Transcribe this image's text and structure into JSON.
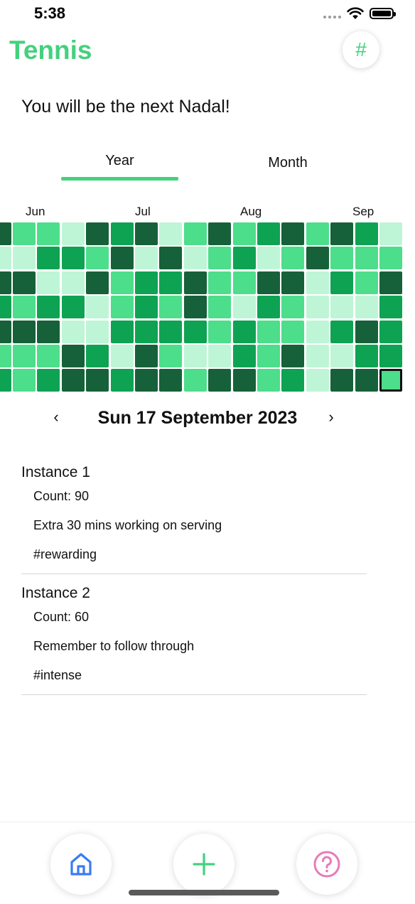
{
  "status_bar": {
    "time": "5:38"
  },
  "header": {
    "title": "Tennis",
    "hash_label": "#"
  },
  "motto": "You will be the next Nadal!",
  "tabs": {
    "year": "Year",
    "month": "Month"
  },
  "heatmap": {
    "months": [
      "Jun",
      "Jul",
      "Aug",
      "Sep"
    ],
    "palette": [
      "#bef5d6",
      "#4cde8a",
      "#0ea352",
      "#166139"
    ],
    "columns": [
      [
        1,
        0,
        3,
        1,
        3,
        1,
        1
      ],
      [
        1,
        2,
        0,
        2,
        3,
        1,
        2
      ],
      [
        0,
        2,
        0,
        2,
        0,
        3,
        3
      ],
      [
        3,
        1,
        3,
        0,
        0,
        2,
        3
      ],
      [
        2,
        3,
        1,
        1,
        2,
        0,
        2
      ],
      [
        3,
        0,
        2,
        2,
        2,
        3,
        3
      ],
      [
        0,
        3,
        2,
        1,
        2,
        1,
        3
      ],
      [
        1,
        0,
        3,
        3,
        2,
        0,
        1
      ],
      [
        3,
        1,
        1,
        1,
        1,
        0,
        3
      ],
      [
        1,
        2,
        1,
        0,
        2,
        2,
        3
      ],
      [
        2,
        0,
        3,
        2,
        1,
        1,
        1
      ],
      [
        3,
        1,
        3,
        1,
        1,
        3,
        2
      ],
      [
        1,
        3,
        0,
        0,
        0,
        0,
        0
      ],
      [
        3,
        1,
        2,
        0,
        2,
        0,
        3
      ],
      [
        2,
        1,
        1,
        0,
        3,
        2,
        3
      ],
      [
        0,
        1,
        3,
        2,
        2,
        2,
        1
      ]
    ],
    "selected": "Sun 17 September 2023"
  },
  "date_nav": {
    "prev": "‹",
    "next": "›",
    "date": "Sun 17 September 2023"
  },
  "instances": [
    {
      "title": "Instance 1",
      "count": "Count: 90",
      "note": "Extra 30 mins working on serving",
      "tag": "#rewarding"
    },
    {
      "title": "Instance 2",
      "count": "Count: 60",
      "note": "Remember to follow through",
      "tag": "#intense"
    }
  ],
  "bottom_bar": {
    "icons": [
      "home-icon",
      "plus-icon",
      "help-icon"
    ],
    "colors": {
      "home": "#3a7bf5",
      "add": "#43d17d",
      "help": "#e77bb8"
    }
  },
  "colors": {
    "accent": "#43d17d"
  }
}
